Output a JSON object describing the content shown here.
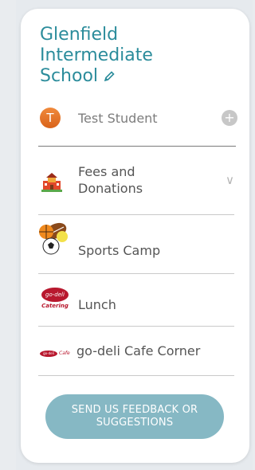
{
  "school": {
    "name": "Glenfield Intermediate School"
  },
  "student": {
    "initial": "T",
    "name": "Test Student",
    "add_symbol": "+"
  },
  "menu": [
    {
      "label": "Fees and Donations",
      "icon": "school-building-icon"
    },
    {
      "label": "Sports Camp",
      "icon": "sports-balls-icon"
    },
    {
      "label": "Lunch",
      "icon": "go-deli-catering-logo"
    },
    {
      "label": "go-deli Cafe Corner",
      "icon": "go-deli-cafe-logo"
    }
  ],
  "feedback": {
    "label": "SEND US FEEDBACK OR SUGGESTIONS"
  },
  "logos": {
    "catering_text": "go-deli",
    "catering_sub": "Catering",
    "cafe_text": "go-deli",
    "cafe_sub": "Cafe"
  },
  "colors": {
    "title": "#2b8c9b",
    "button": "#86b8c4",
    "avatar": "#e3782e"
  }
}
